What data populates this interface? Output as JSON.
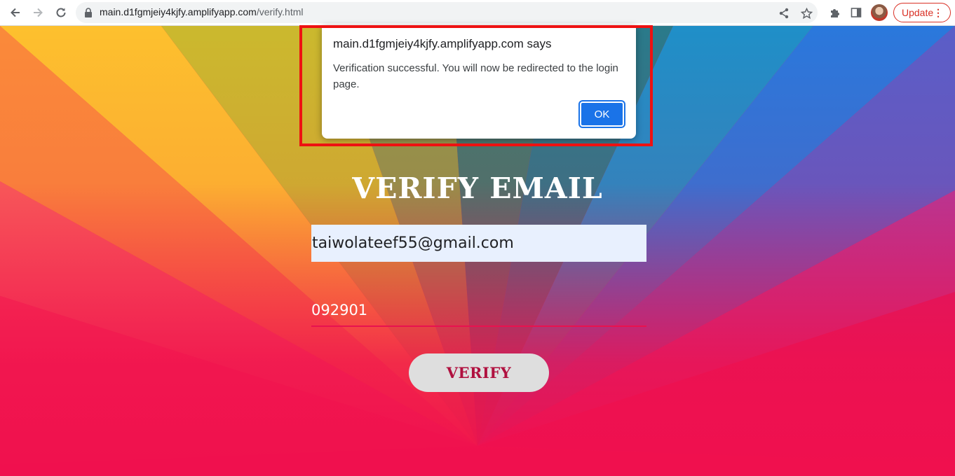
{
  "browser": {
    "url_host": "main.d1fgmjeiy4kjfy.amplifyapp.com",
    "url_path": "/verify.html",
    "update_label": "Update",
    "menu_glyph": "⋮",
    "icons": {
      "back": "arrow-left-icon",
      "forward": "arrow-right-icon",
      "reload": "reload-icon",
      "lock": "lock-icon",
      "share": "share-icon",
      "bookmark": "star-icon",
      "extensions": "puzzle-icon",
      "side_panel": "side-panel-icon"
    }
  },
  "page": {
    "heading": "VERIFY EMAIL",
    "email_value": "taiwolateef55@gmail.com",
    "code_value": "092901",
    "verify_button": "VERIFY"
  },
  "dialog": {
    "title": "main.d1fgmjeiy4kjfy.amplifyapp.com says",
    "message": "Verification successful. You will now be redirected to the login page.",
    "ok_label": "OK"
  },
  "colors": {
    "accent_pink": "#e8124f",
    "button_text": "#b0103f",
    "dialog_button": "#1a73e8",
    "highlight": "#ee1111"
  }
}
